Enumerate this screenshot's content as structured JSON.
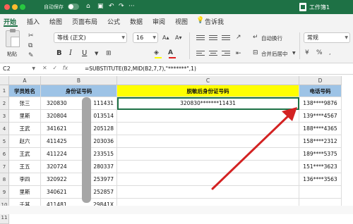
{
  "titlebar": {
    "autosave_label": "自动保存",
    "document_title": "工作簿1"
  },
  "ribbon_tabs": [
    "开始",
    "插入",
    "绘图",
    "页面布局",
    "公式",
    "数据",
    "审阅",
    "视图"
  ],
  "help": {
    "label": "告诉我"
  },
  "ribbon": {
    "paste_label": "粘贴",
    "font_name": "等线 (正文)",
    "font_size": "16",
    "wrap_text_label": "自动换行",
    "merge_center_label": "合并后居中",
    "number_format": "常规"
  },
  "formula_bar": {
    "name_box": "C2",
    "formula": "=SUBSTITUTE(B2,MID(B2,7,7),\"*******\",1)"
  },
  "sheet": {
    "columns": [
      "A",
      "B",
      "C",
      "D"
    ],
    "rows": [
      "1",
      "2",
      "3",
      "4",
      "5",
      "6",
      "7",
      "8",
      "9",
      "10",
      "11"
    ],
    "headers": {
      "a": "学员姓名",
      "b": "身份证号码",
      "c": "脱敏后身份证号码",
      "d": "电话号码"
    },
    "data": [
      {
        "name": "张三",
        "id_start": "320830",
        "id_end": "111431",
        "masked": "320830*******11431",
        "phone": "138****9876"
      },
      {
        "name": "里斯",
        "id_start": "320804",
        "id_end": "013514",
        "masked": "",
        "phone": "139****4567"
      },
      {
        "name": "王武",
        "id_start": "341621",
        "id_end": "205128",
        "masked": "",
        "phone": "188****4365"
      },
      {
        "name": "赵六",
        "id_start": "411425",
        "id_end": "203036",
        "masked": "",
        "phone": "158****2312"
      },
      {
        "name": "王武",
        "id_start": "411224",
        "id_end": "233515",
        "masked": "",
        "phone": "189****5375"
      },
      {
        "name": "王五",
        "id_start": "320724",
        "id_end": "280337",
        "masked": "",
        "phone": "151****3623"
      },
      {
        "name": "李四",
        "id_start": "320922",
        "id_end": "253977",
        "masked": "",
        "phone": "136****3563"
      },
      {
        "name": "里斯",
        "id_start": "340621",
        "id_end": "252857",
        "masked": "",
        "phone": ""
      },
      {
        "name": "千其",
        "id_start": "411481",
        "id_end": "29841X",
        "masked": "",
        "phone": ""
      }
    ]
  },
  "colors": {
    "title_green": "#1e7145",
    "header_blue": "#9dc3e6",
    "header_yellow": "#ffff00",
    "arrow_red": "#d32222"
  }
}
